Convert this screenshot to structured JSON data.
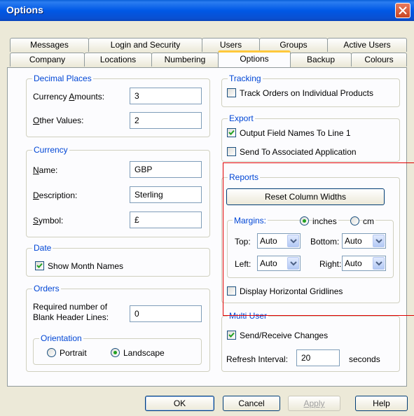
{
  "window": {
    "title": "Options"
  },
  "tabs_row1": [
    "Messages",
    "Login and Security",
    "Users",
    "Groups",
    "Active Users"
  ],
  "tabs_row2": [
    "Company",
    "Locations",
    "Numbering",
    "Options",
    "Backup",
    "Colours"
  ],
  "decimal_places": {
    "label": "Decimal Places",
    "currency_amounts_pre": "Currency ",
    "currency_amounts_u": "A",
    "currency_amounts_post": "mounts:",
    "currency_amounts_value": "3",
    "other_values_u": "O",
    "other_values_post": "ther Values:",
    "other_values_value": "2"
  },
  "currency": {
    "label": "Currency",
    "name_u": "N",
    "name_post": "ame:",
    "name_value": "GBP",
    "description_u": "D",
    "description_post": "escription:",
    "description_value": "Sterling",
    "symbol_u": "S",
    "symbol_post": "ymbol:",
    "symbol_value": "£"
  },
  "date": {
    "label": "Date",
    "show_month_names": "Show Month Names"
  },
  "orders": {
    "label": "Orders",
    "required_line1": "Required number of",
    "required_line2": "Blank Header Lines:",
    "required_value": "0",
    "orientation_label": "Orientation",
    "portrait": "Portrait",
    "landscape": "Landscape"
  },
  "tracking": {
    "label": "Tracking",
    "track_orders": "Track Orders on Individual Products"
  },
  "export": {
    "label": "Export",
    "output_field_names": "Output Field Names To Line 1",
    "send_associated": "Send To Associated Application"
  },
  "reports": {
    "label": "Reports",
    "reset_column_widths": "Reset Column Widths",
    "margins_label": "Margins:",
    "inches": "inches",
    "cm": "cm",
    "top_label": "Top:",
    "top_value": "Auto",
    "bottom_label": "Bottom:",
    "bottom_value": "Auto",
    "left_label": "Left:",
    "left_value": "Auto",
    "right_label": "Right:",
    "right_value": "Auto",
    "display_gridlines": "Display Horizontal Gridlines"
  },
  "multi_user": {
    "label": "Multi User",
    "send_receive": "Send/Receive Changes",
    "refresh_interval": "Refresh Interval:",
    "refresh_value": "20",
    "seconds": "seconds"
  },
  "buttons": {
    "ok": "OK",
    "cancel": "Cancel",
    "apply": "Apply",
    "help": "Help"
  },
  "colors": {
    "title_bar": "#0058e6",
    "group_label": "#0046d5",
    "highlight_box": "#e00000"
  }
}
